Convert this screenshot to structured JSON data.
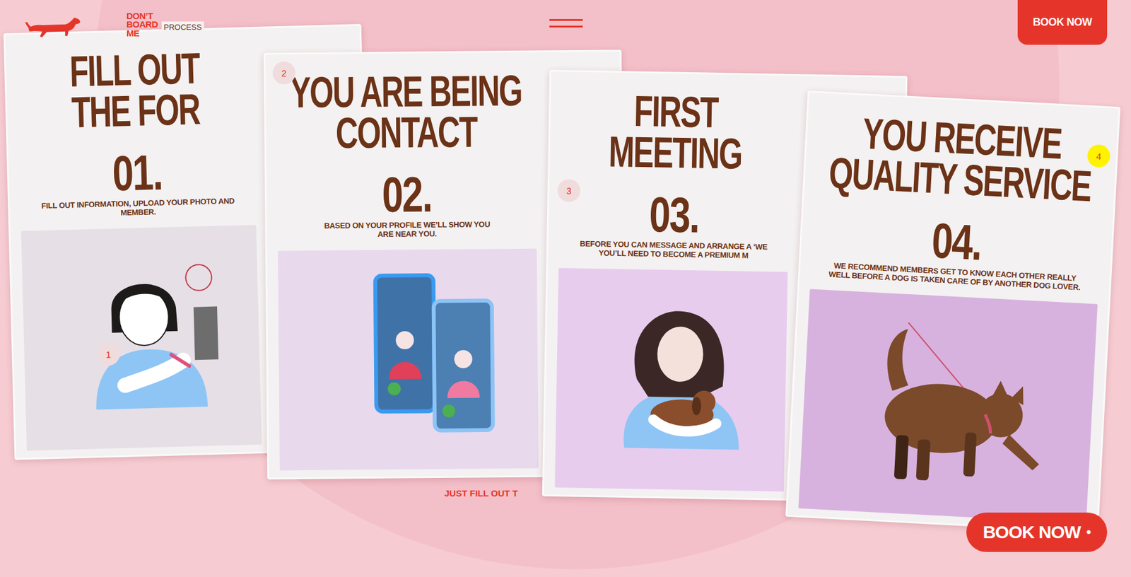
{
  "brand": {
    "logo_lines": [
      "DON’T",
      "BOARD",
      "ME"
    ],
    "section": "PROCESS"
  },
  "nav": {
    "book_button": "BOOK NOW"
  },
  "steps": [
    {
      "badge": "1",
      "selected": false,
      "title_lines": [
        "FILL OUT",
        "THE FOR"
      ],
      "number": "01.",
      "description_lines": [
        "FILL OUT INFORMATION, UPLOAD YOUR PHOTO AND",
        "MEMBER."
      ]
    },
    {
      "badge": "2",
      "selected": false,
      "title_lines": [
        "YOU ARE BEING",
        "CONTACT"
      ],
      "number": "02.",
      "description_lines": [
        "BASED ON YOUR PROFILE WE’LL SHOW YOU",
        "ARE NEAR YOU."
      ]
    },
    {
      "badge": "3",
      "selected": false,
      "title_lines": [
        "FIRST",
        "MEETING"
      ],
      "number": "03.",
      "description_lines": [
        "BEFORE YOU CAN MESSAGE AND ARRANGE A ‘WE",
        "YOU’LL NEED TO BECOME A PREMIUM M"
      ]
    },
    {
      "badge": "4",
      "selected": true,
      "title_lines": [
        "YOU RECEIVE",
        "QUALITY SERVICE"
      ],
      "number": "04.",
      "description_lines": [
        "WE RECOMMEND MEMBERS GET TO KNOW EACH OTHER REALLY",
        "WELL BEFORE A DOG IS TAKEN CARE OF BY ANOTHER DOG LOVER."
      ]
    }
  ],
  "footer_text": "JUST FILL OUT T",
  "floating_button": {
    "label": "BOOK NOW",
    "dot": "•"
  }
}
